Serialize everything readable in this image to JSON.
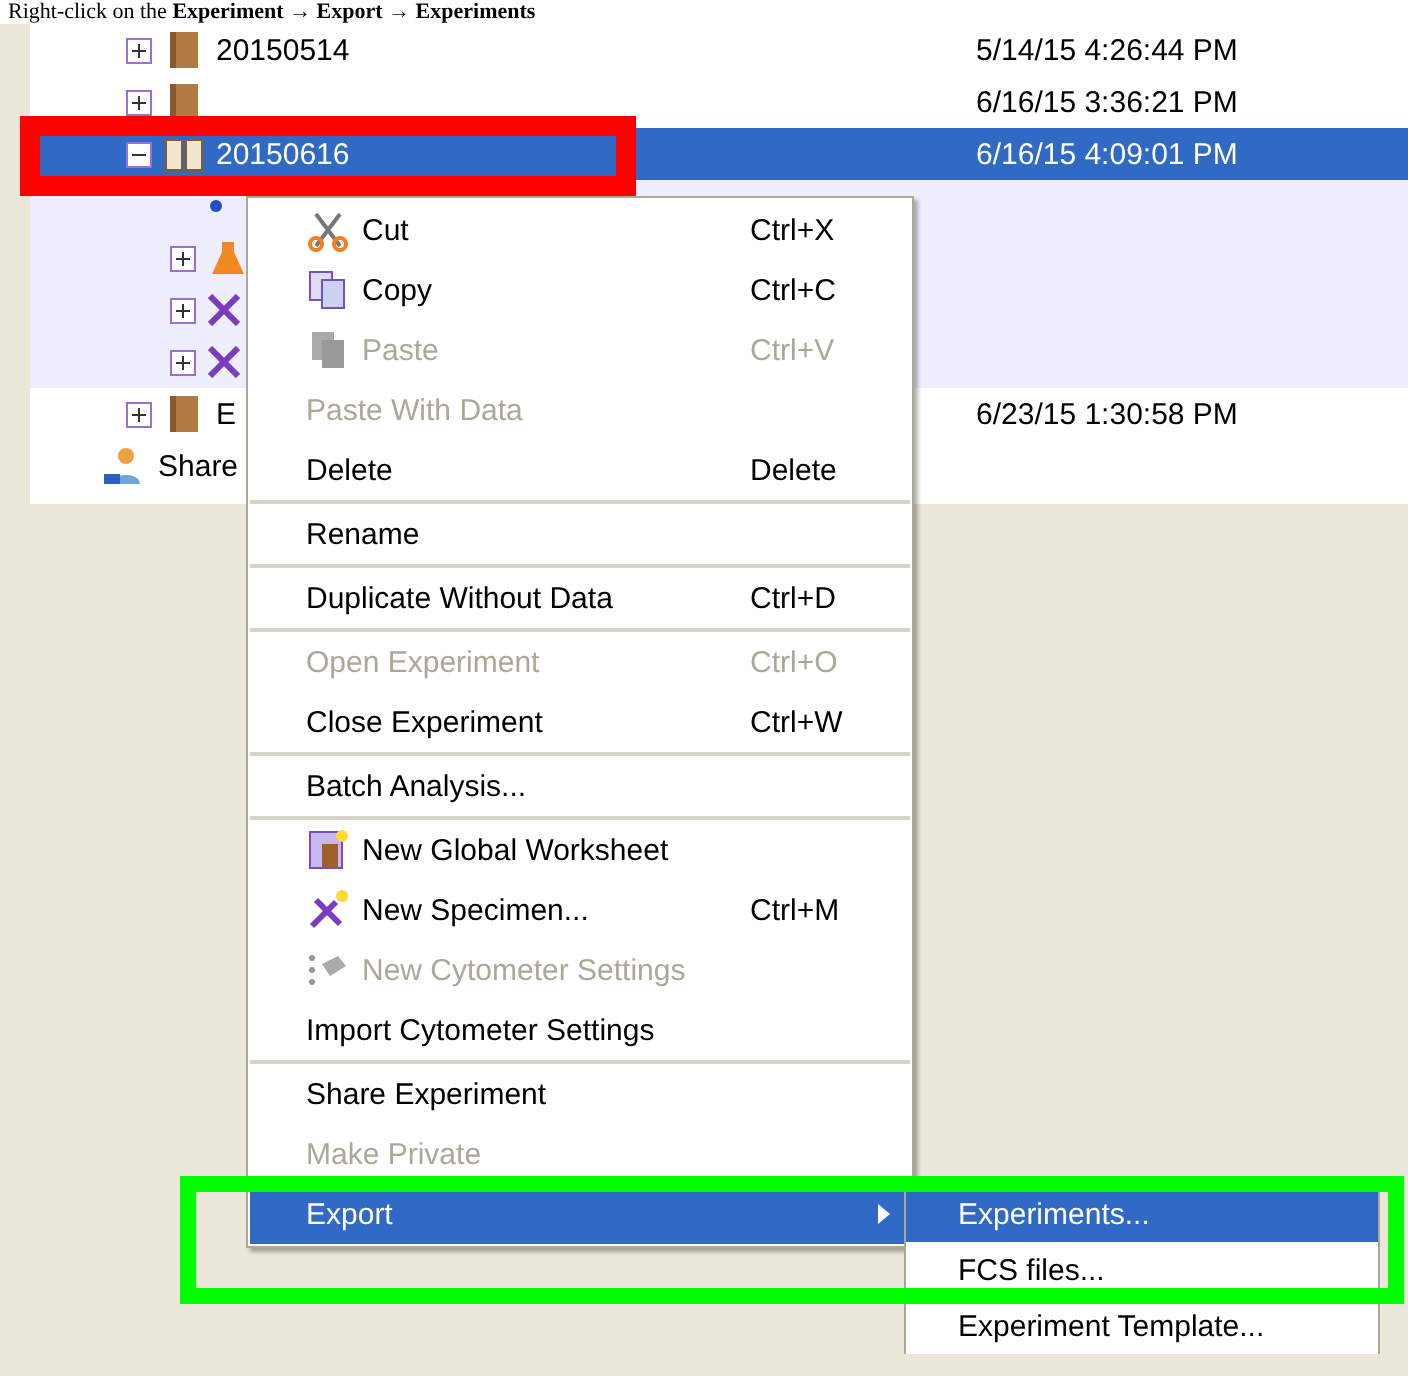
{
  "caption": {
    "text": "Right-click on the **Experiment → Export → Experiments**"
  },
  "tree": {
    "rows": [
      {
        "kind": "experiment",
        "label": "20150514",
        "date": "5/14/15 4:26:44 PM",
        "expanded": false,
        "selected": false
      },
      {
        "kind": "experiment",
        "date": "6/16/15 3:36:21 PM",
        "expanded": false,
        "selected": false
      },
      {
        "kind": "open-experiment",
        "label": "20150616",
        "date": "6/16/15 4:09:01 PM",
        "expanded": true,
        "selected": true,
        "children": [
          {
            "kind": "leaf"
          },
          {
            "kind": "worksheet",
            "expanded": false
          },
          {
            "kind": "specimen",
            "expanded": false
          },
          {
            "kind": "specimen",
            "expanded": false
          }
        ]
      },
      {
        "kind": "experiment",
        "label": "E",
        "date": "6/23/15 1:30:58 PM",
        "expanded": false,
        "selected": false
      },
      {
        "kind": "shared",
        "label": "Share"
      }
    ]
  },
  "menu": {
    "items": [
      {
        "kind": "cut",
        "label": "Cut",
        "shortcut": "Ctrl+X",
        "disabled": false,
        "selected": false
      },
      {
        "kind": "copy",
        "label": "Copy",
        "shortcut": "Ctrl+C",
        "disabled": false,
        "selected": false
      },
      {
        "kind": "paste",
        "label": "Paste",
        "shortcut": "Ctrl+V",
        "disabled": true,
        "selected": false
      },
      {
        "kind": "item",
        "label": "Paste With Data",
        "disabled": true,
        "selected": false
      },
      {
        "kind": "item",
        "label": "Delete",
        "shortcut": "Delete",
        "disabled": false,
        "selected": false
      },
      {
        "kind": "separator"
      },
      {
        "kind": "item",
        "label": "Rename",
        "disabled": false,
        "selected": false
      },
      {
        "kind": "separator"
      },
      {
        "kind": "item",
        "label": "Duplicate Without Data",
        "shortcut": "Ctrl+D",
        "disabled": false,
        "selected": false
      },
      {
        "kind": "separator"
      },
      {
        "kind": "item",
        "label": "Open Experiment",
        "shortcut": "Ctrl+O",
        "disabled": true,
        "selected": false
      },
      {
        "kind": "item",
        "label": "Close Experiment",
        "shortcut": "Ctrl+W",
        "disabled": false,
        "selected": false
      },
      {
        "kind": "separator"
      },
      {
        "kind": "item",
        "label": "Batch Analysis...",
        "disabled": false,
        "selected": false
      },
      {
        "kind": "separator"
      },
      {
        "kind": "worksheet",
        "label": "New Global Worksheet",
        "disabled": false,
        "selected": false
      },
      {
        "kind": "specimen",
        "label": "New Specimen...",
        "shortcut": "Ctrl+M",
        "disabled": false,
        "selected": false
      },
      {
        "kind": "cytometer",
        "label": "New Cytometer Settings",
        "disabled": true,
        "selected": false
      },
      {
        "kind": "item",
        "label": "Import Cytometer Settings",
        "disabled": false,
        "selected": false
      },
      {
        "kind": "separator"
      },
      {
        "kind": "item",
        "label": "Share Experiment",
        "disabled": false,
        "selected": false
      },
      {
        "kind": "item",
        "label": "Make Private",
        "disabled": true,
        "selected": false
      },
      {
        "kind": "item",
        "label": "Export",
        "disabled": false,
        "selected": true,
        "submenu": true
      }
    ]
  },
  "submenu": {
    "items": [
      {
        "label": "Experiments...",
        "selected": true
      },
      {
        "label": "FCS files...",
        "selected": false
      },
      {
        "label": "Experiment Template...",
        "selected": false
      }
    ]
  },
  "highlights": [
    {
      "color": "#ff0000"
    },
    {
      "color": "#00ff00"
    }
  ]
}
